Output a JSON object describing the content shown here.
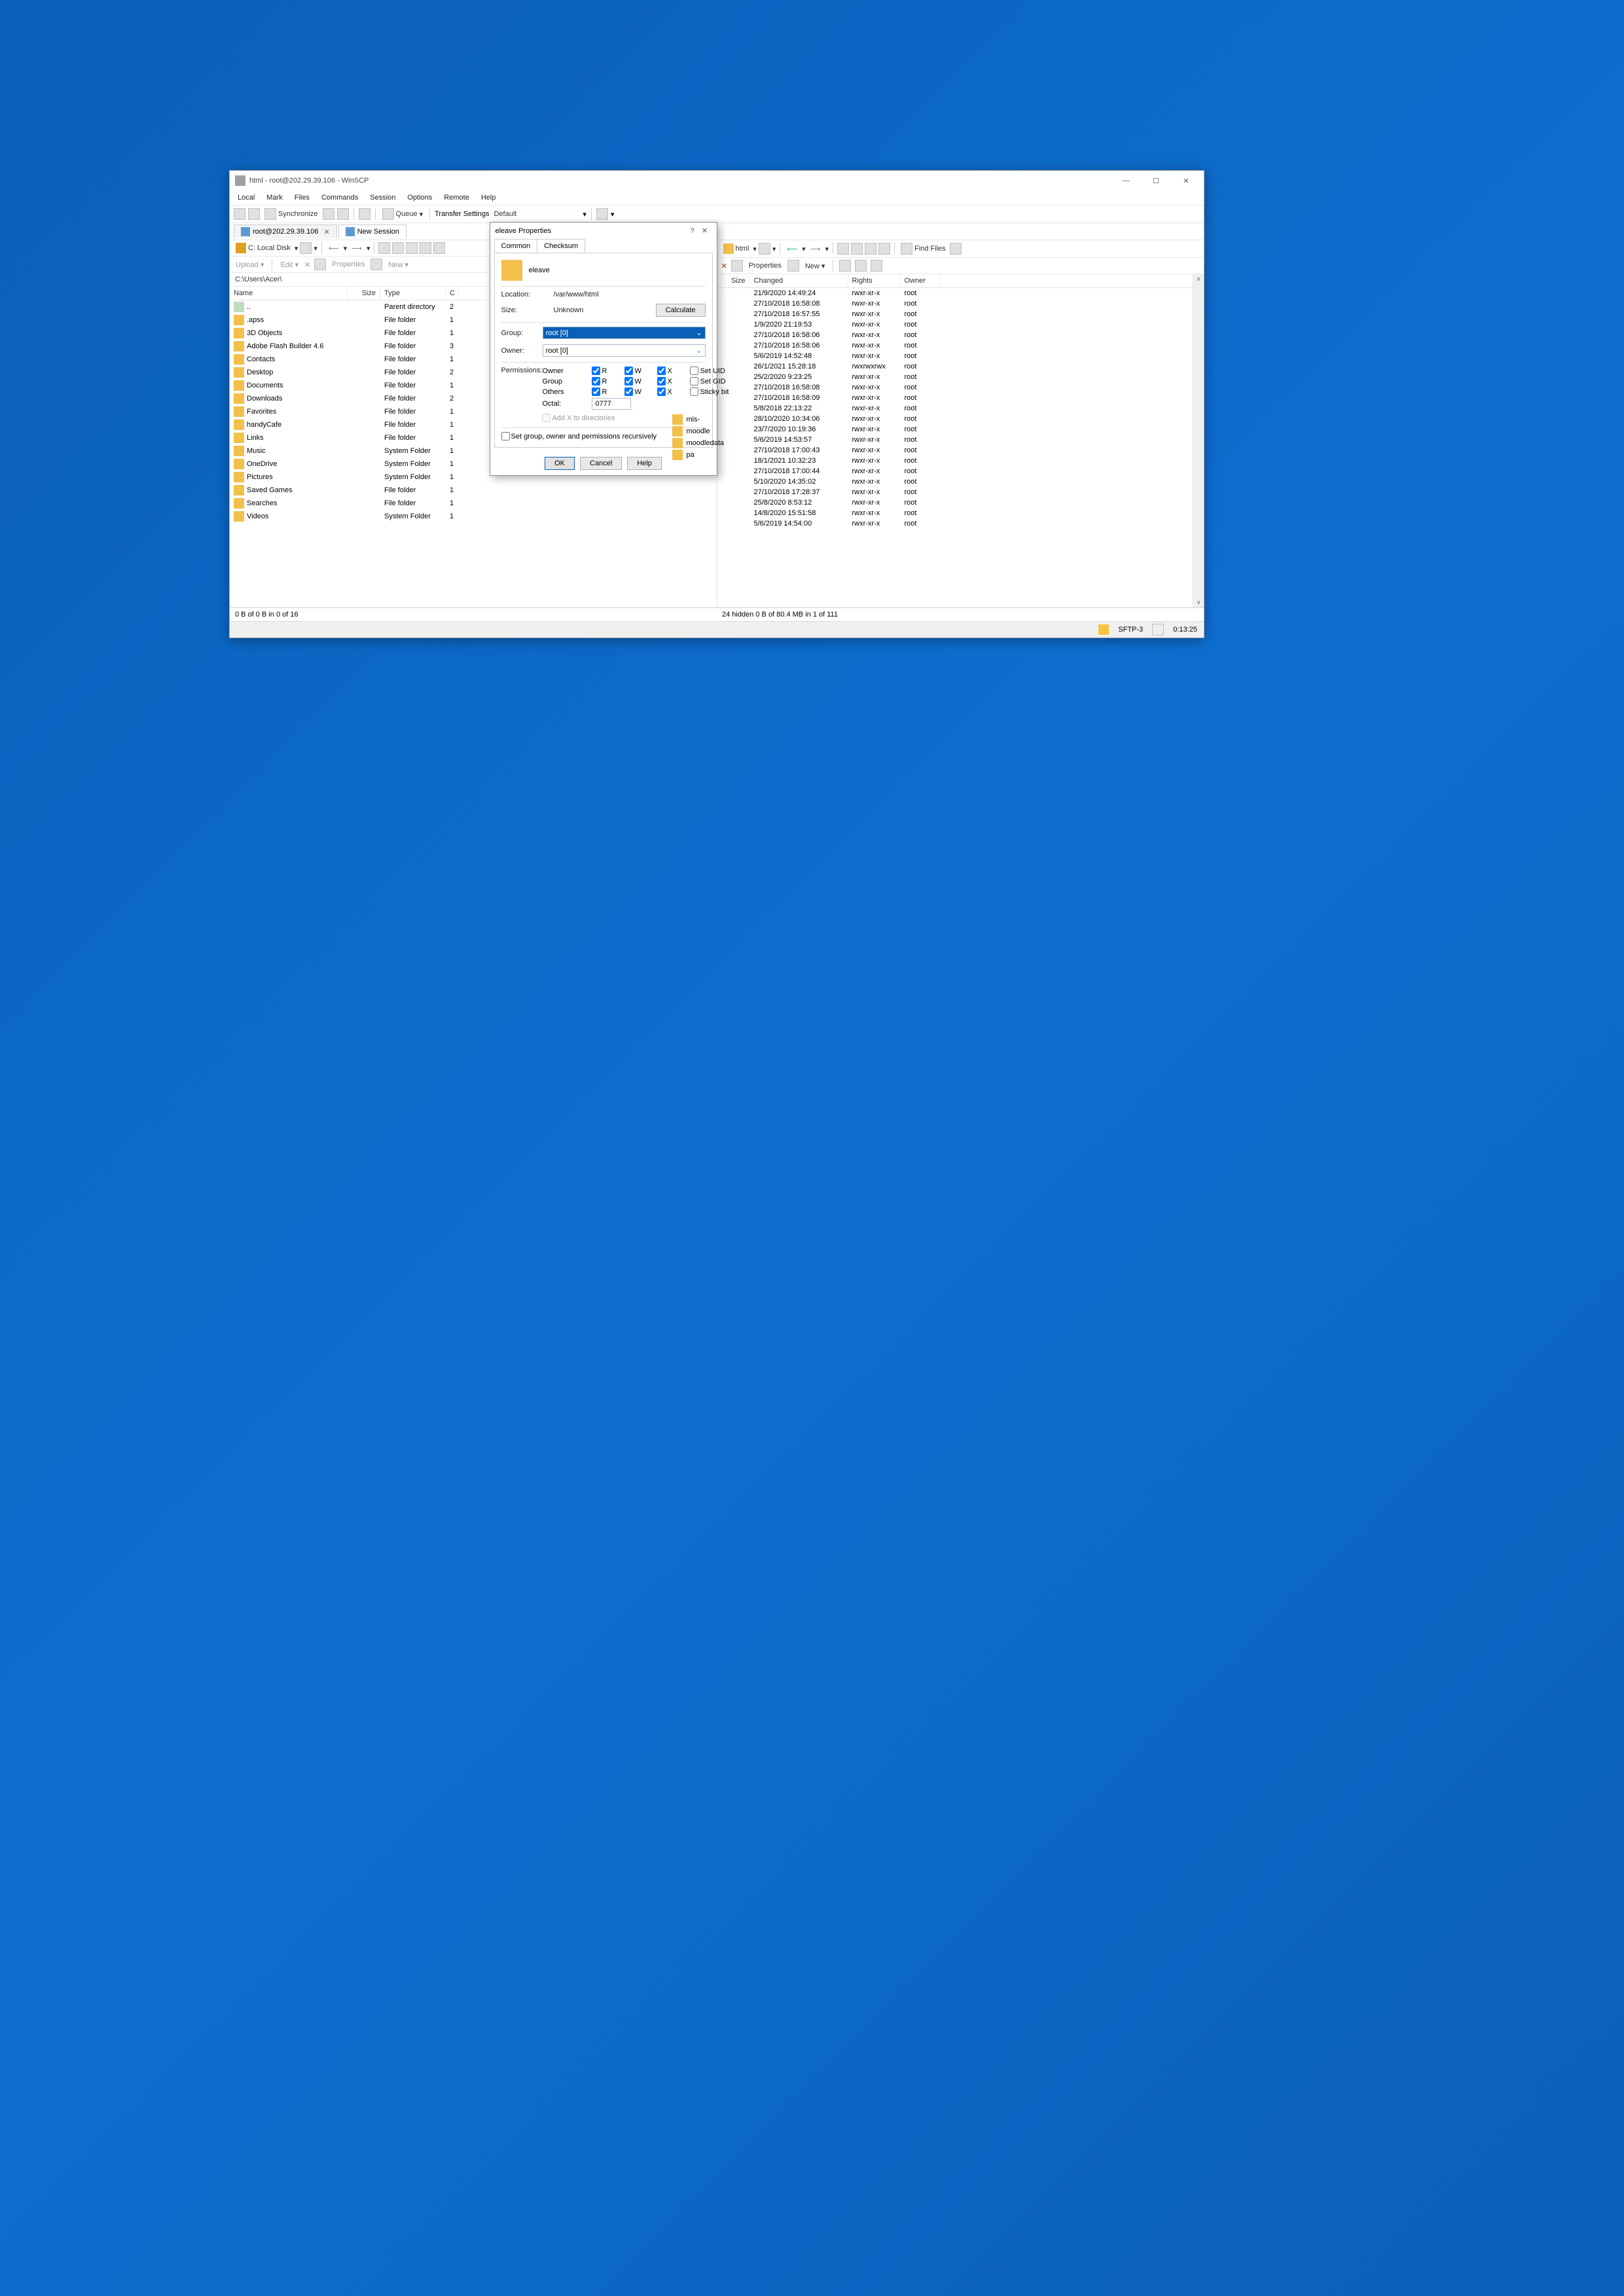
{
  "window": {
    "title": "html - root@202.29.39.106 - WinSCP",
    "min": "—",
    "max": "☐",
    "close": "✕"
  },
  "menu": [
    "Local",
    "Mark",
    "Files",
    "Commands",
    "Session",
    "Options",
    "Remote",
    "Help"
  ],
  "toolbar": {
    "sync": "Synchronize",
    "queue": "Queue",
    "transfer": "Transfer Settings",
    "transferProfile": "Default"
  },
  "sessions": {
    "tab1": "root@202.29.39.106",
    "tab2": "New Session"
  },
  "left": {
    "drive": "C: Local Disk",
    "actions": {
      "upload": "Upload",
      "edit": "Edit",
      "props": "Properties",
      "new": "New"
    },
    "path": "C:\\Users\\Acer\\",
    "headers": {
      "name": "Name",
      "size": "Size",
      "type": "Type",
      "c": "C"
    },
    "rows": [
      {
        "name": "..",
        "type": "Parent directory",
        "c": "2",
        "icon": "upfolder"
      },
      {
        "name": ".apss",
        "type": "File folder",
        "c": "1",
        "icon": "folder"
      },
      {
        "name": "3D Objects",
        "type": "File folder",
        "c": "1",
        "icon": "folder"
      },
      {
        "name": "Adobe Flash Builder 4.6",
        "type": "File folder",
        "c": "3",
        "icon": "folder"
      },
      {
        "name": "Contacts",
        "type": "File folder",
        "c": "1",
        "icon": "folder"
      },
      {
        "name": "Desktop",
        "type": "File folder",
        "c": "2",
        "icon": "folder"
      },
      {
        "name": "Documents",
        "type": "File folder",
        "c": "1",
        "icon": "folder"
      },
      {
        "name": "Downloads",
        "type": "File folder",
        "c": "2",
        "icon": "folder"
      },
      {
        "name": "Favorites",
        "type": "File folder",
        "c": "1",
        "icon": "folder"
      },
      {
        "name": "handyCafe",
        "type": "File folder",
        "c": "1",
        "icon": "folder"
      },
      {
        "name": "Links",
        "type": "File folder",
        "c": "1",
        "icon": "folder"
      },
      {
        "name": "Music",
        "type": "System Folder",
        "c": "1",
        "icon": "folder"
      },
      {
        "name": "OneDrive",
        "type": "System Folder",
        "c": "1",
        "icon": "folder"
      },
      {
        "name": "Pictures",
        "type": "System Folder",
        "c": "1",
        "icon": "folder"
      },
      {
        "name": "Saved Games",
        "type": "File folder",
        "c": "1",
        "icon": "folder"
      },
      {
        "name": "Searches",
        "type": "File folder",
        "c": "1",
        "icon": "folder"
      },
      {
        "name": "Videos",
        "type": "System Folder",
        "c": "1",
        "icon": "folder"
      }
    ],
    "status": "0 B of 0 B in 0 of 16"
  },
  "right": {
    "drive": "html",
    "actions": {
      "props": "Properties",
      "new": "New",
      "find": "Find Files"
    },
    "headers": {
      "size": "Size",
      "changed": "Changed",
      "rights": "Rights",
      "owner": "Owner"
    },
    "rows": [
      {
        "changed": "21/9/2020 14:49:24",
        "rights": "rwxr-xr-x",
        "owner": "root"
      },
      {
        "changed": "27/10/2018 16:58:08",
        "rights": "rwxr-xr-x",
        "owner": "root"
      },
      {
        "changed": "27/10/2018 16:57:55",
        "rights": "rwxr-xr-x",
        "owner": "root"
      },
      {
        "changed": "1/9/2020 21:19:53",
        "rights": "rwxr-xr-x",
        "owner": "root"
      },
      {
        "changed": "27/10/2018 16:58:06",
        "rights": "rwxr-xr-x",
        "owner": "root"
      },
      {
        "changed": "27/10/2018 16:58:06",
        "rights": "rwxr-xr-x",
        "owner": "root"
      },
      {
        "changed": "5/6/2019 14:52:48",
        "rights": "rwxr-xr-x",
        "owner": "root"
      },
      {
        "changed": "26/1/2021 15:28:18",
        "rights": "rwxrwxrwx",
        "owner": "root"
      },
      {
        "changed": "25/2/2020 9:23:25",
        "rights": "rwxr-xr-x",
        "owner": "root"
      },
      {
        "changed": "27/10/2018 16:58:08",
        "rights": "rwxr-xr-x",
        "owner": "root"
      },
      {
        "changed": "27/10/2018 16:58:09",
        "rights": "rwxr-xr-x",
        "owner": "root"
      },
      {
        "changed": "5/8/2018 22:13:22",
        "rights": "rwxr-xr-x",
        "owner": "root"
      },
      {
        "changed": "28/10/2020 10:34:06",
        "rights": "rwxr-xr-x",
        "owner": "root"
      },
      {
        "changed": "23/7/2020 10:19:36",
        "rights": "rwxr-xr-x",
        "owner": "root"
      },
      {
        "changed": "5/6/2019 14:53:57",
        "rights": "rwxr-xr-x",
        "owner": "root"
      },
      {
        "changed": "27/10/2018 17:00:43",
        "rights": "rwxr-xr-x",
        "owner": "root"
      },
      {
        "changed": "18/1/2021 10:32:23",
        "rights": "rwxr-xr-x",
        "owner": "root"
      },
      {
        "changed": "27/10/2018 17:00:44",
        "rights": "rwxr-xr-x",
        "owner": "root"
      },
      {
        "changed": "5/10/2020 14:35:02",
        "rights": "rwxr-xr-x",
        "owner": "root"
      },
      {
        "changed": "27/10/2018 17:28:37",
        "rights": "rwxr-xr-x",
        "owner": "root"
      },
      {
        "changed": "25/8/2020 8:53:12",
        "rights": "rwxr-xr-x",
        "owner": "root"
      },
      {
        "changed": "14/8/2020 15:51:58",
        "rights": "rwxr-xr-x",
        "owner": "root"
      },
      {
        "changed": "5/6/2019 14:54:00",
        "rights": "rwxr-xr-x",
        "owner": "root"
      }
    ],
    "stubs": [
      "mis-",
      "moodle",
      "moodledata",
      "pa"
    ],
    "status": "24 hidden   0 B of 80.4 MB in 1 of 111"
  },
  "bottom": {
    "proto": "SFTP-3",
    "time": "0:13:25"
  },
  "dialog": {
    "title": "eleave Properties",
    "tabs": {
      "common": "Common",
      "checksum": "Checksum"
    },
    "name": "eleave",
    "locLabel": "Location:",
    "location": "/var/www/html",
    "sizeLabel": "Size:",
    "size": "Unknown",
    "calc": "Calculate",
    "groupLabel": "Group:",
    "group": "root [0]",
    "ownerLabel": "Owner:",
    "owner": "root [0]",
    "permLabel": "Permissions:",
    "perm": {
      "owner": "Owner",
      "group": "Group",
      "others": "Others",
      "R": "R",
      "W": "W",
      "X": "X",
      "setuid": "Set UID",
      "setgid": "Set GID",
      "sticky": "Sticky bit",
      "octalLabel": "Octal:",
      "octal": "0777",
      "addx": "Add X to directories"
    },
    "recursive": "Set group, owner and permissions recursively",
    "ok": "OK",
    "cancel": "Cancel",
    "help": "Help"
  }
}
